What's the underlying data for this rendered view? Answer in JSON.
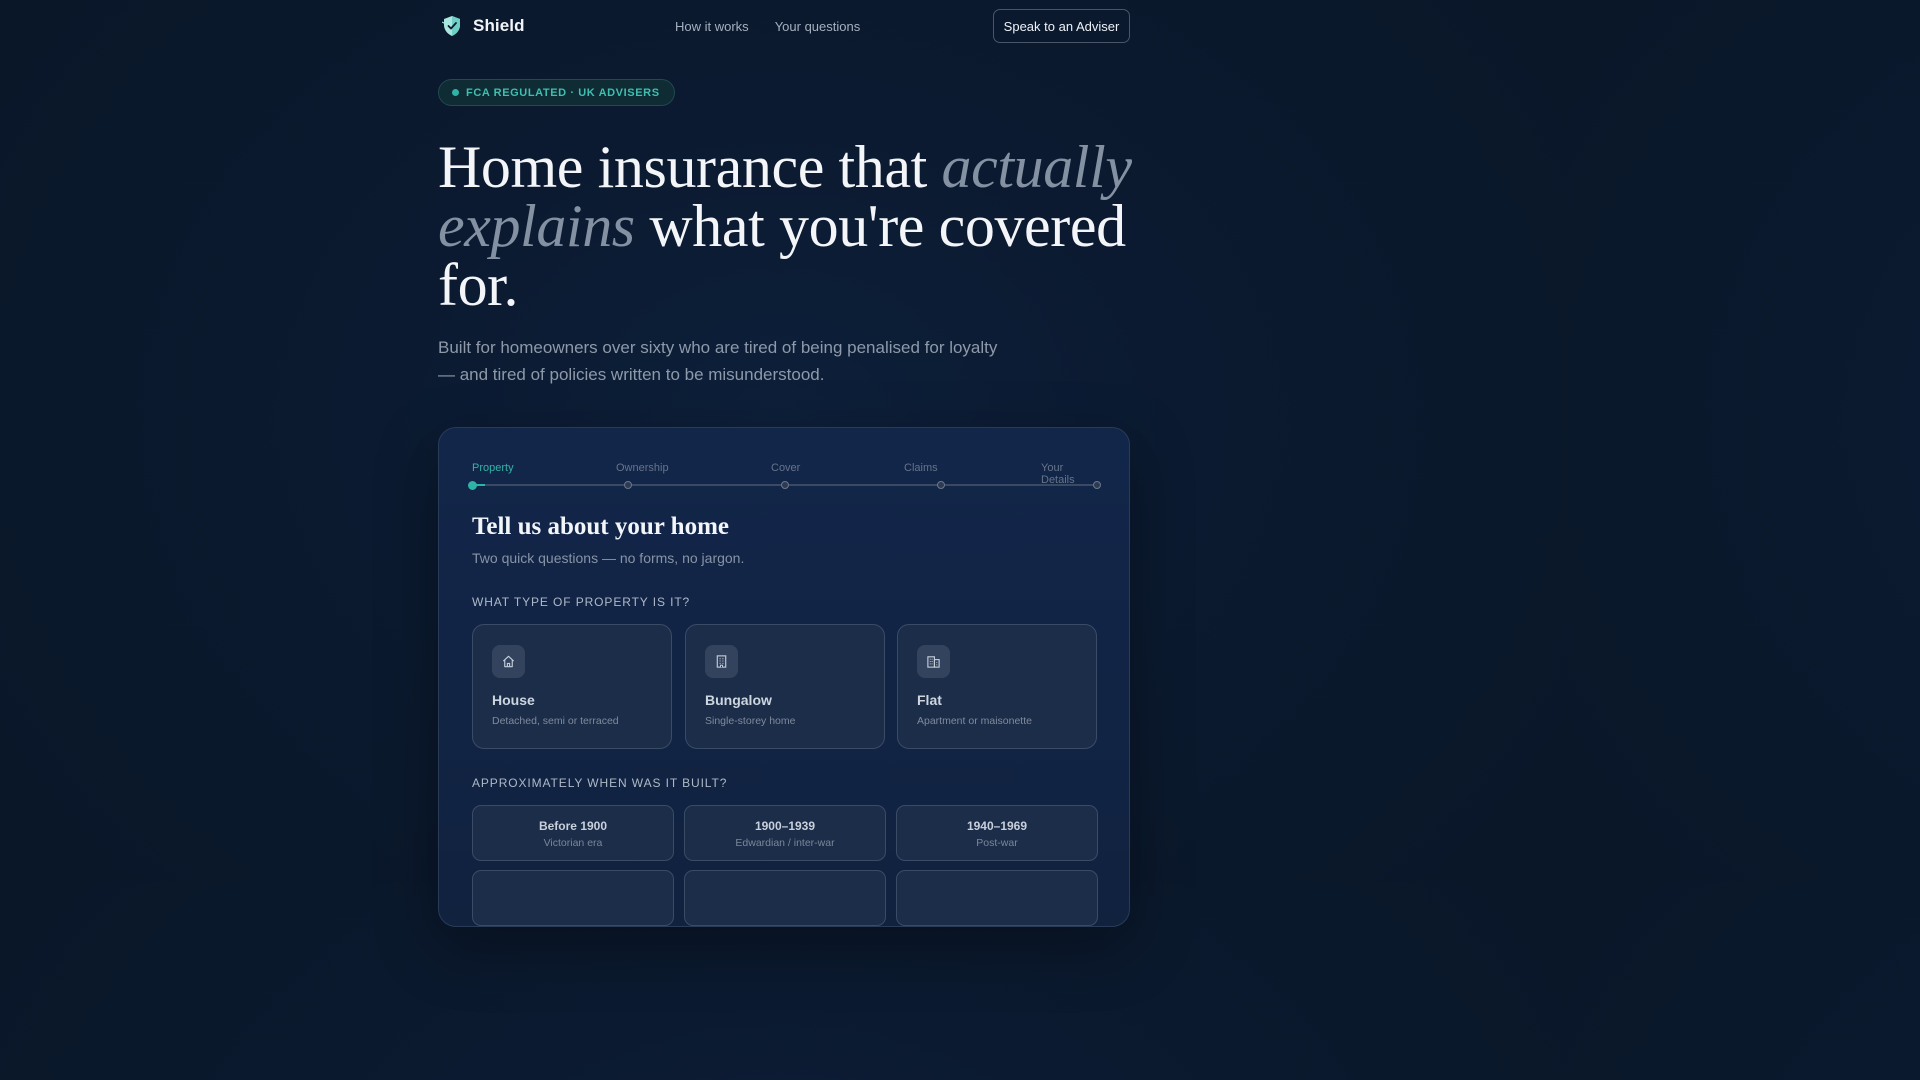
{
  "header": {
    "brand": "Shield",
    "nav": [
      "How it works",
      "Your questions"
    ],
    "cta": "Speak to an Adviser"
  },
  "badge": {
    "text": "FCA REGULATED · UK ADVISERS"
  },
  "hero": {
    "title_part1": "Home insurance that ",
    "title_em1": "actually",
    "title_em2": "explains",
    "title_part2": " what you're covered for.",
    "subtitle": "Built for homeowners over sixty who are tired of being penalised for loyalty — and tired of policies written to be misunderstood."
  },
  "card": {
    "steps": [
      {
        "label": "Property",
        "active": true
      },
      {
        "label": "Ownership",
        "active": false
      },
      {
        "label": "Cover",
        "active": false
      },
      {
        "label": "Claims",
        "active": false
      },
      {
        "label": "Your Details",
        "active": false
      }
    ],
    "progress": 0.02,
    "title": "Tell us about your home",
    "subtitle": "Two quick questions — no forms, no jargon.",
    "property_question": "WHAT TYPE OF PROPERTY IS IT?",
    "property_types": [
      {
        "name": "House",
        "desc": "Detached, semi or terraced",
        "icon": "house-icon"
      },
      {
        "name": "Bungalow",
        "desc": "Single-storey home",
        "icon": "bungalow-icon"
      },
      {
        "name": "Flat",
        "desc": "Apartment or maisonette",
        "icon": "flat-icon"
      }
    ],
    "built_question": "APPROXIMATELY WHEN WAS IT BUILT?",
    "eras": [
      {
        "name": "Before 1900",
        "desc": "Victorian era"
      },
      {
        "name": "1900–1939",
        "desc": "Edwardian / inter-war"
      },
      {
        "name": "1940–1969",
        "desc": "Post-war"
      }
    ]
  },
  "colors": {
    "accent": "#2fb3a6",
    "background": "#0b1a30",
    "card": "#12264a"
  }
}
